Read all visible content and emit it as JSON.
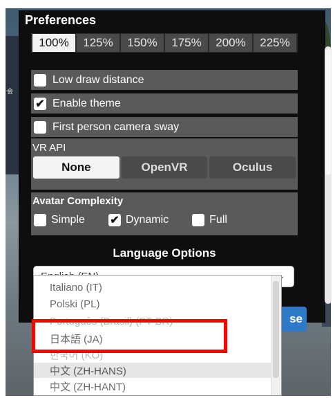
{
  "preferences": {
    "title": "Preferences",
    "zoom_options": [
      "100%",
      "125%",
      "150%",
      "175%",
      "200%",
      "225%"
    ],
    "zoom_selected": "100%",
    "toggles": [
      {
        "label": "Low draw distance",
        "checked": false
      },
      {
        "label": "Enable theme",
        "checked": true
      },
      {
        "label": "First person camera sway",
        "checked": false
      }
    ],
    "vr_api": {
      "title": "VR API",
      "options": [
        "None",
        "OpenVR",
        "Oculus"
      ],
      "selected": "None"
    },
    "avatar": {
      "title": "Avatar Complexity",
      "options": [
        {
          "label": "Simple",
          "checked": false
        },
        {
          "label": "Dynamic",
          "checked": true
        },
        {
          "label": "Full",
          "checked": false
        }
      ]
    },
    "language": {
      "title": "Language Options",
      "selected": "English (EN)",
      "chevron_icon": "chevron-down-icon",
      "dropdown_items": [
        "Italiano (IT)",
        "Polski (PL)",
        "Português (Brasil) (PT-BR)",
        "日本語 (JA)",
        "한국어 (KO)",
        "中文 (ZH-HANS)",
        "中文 (ZH-HANT)"
      ],
      "highlighted_item": "中文 (ZH-HANS)"
    },
    "bottom_button_text": "se"
  },
  "colors": {
    "panel_bg": "#0e0e0e",
    "row_bg": "#5a5a5a",
    "accent_blue": "#2f79c9",
    "highlight_red": "#ff0000"
  }
}
